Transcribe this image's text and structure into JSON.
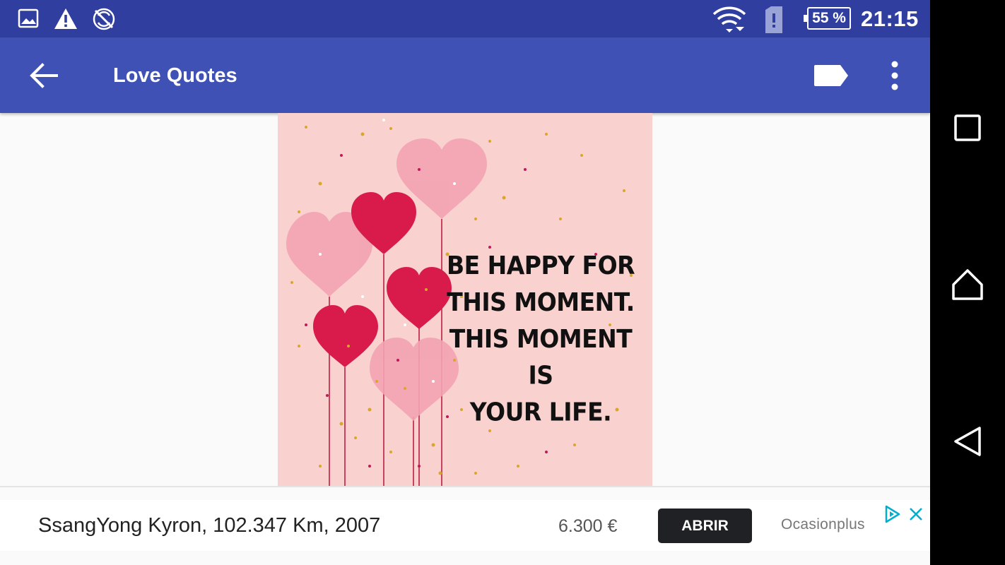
{
  "status_bar": {
    "icons_left": [
      "image-icon",
      "warning-icon",
      "no-sync-icon"
    ],
    "icons_right": [
      "wifi-icon",
      "sim-alert-icon"
    ],
    "battery": "55 %",
    "time": "21:15"
  },
  "app_bar": {
    "title": "Love Quotes"
  },
  "quote": {
    "lines": [
      "BE HAPPY FOR",
      "THIS MOMENT.",
      "THIS MOMENT IS",
      "YOUR LIFE."
    ]
  },
  "ad": {
    "title": "SsangYong Kyron, 102.347 Km, 2007",
    "price": "6.300 €",
    "cta": "ABRIR",
    "advertiser": "Ocasionplus"
  },
  "colors": {
    "status_bar": "#303f9f",
    "app_bar": "#3f51b5",
    "image_background": "#f9d2cf",
    "heart_pink": "#f09aa8",
    "heart_red": "#d81b4a"
  }
}
